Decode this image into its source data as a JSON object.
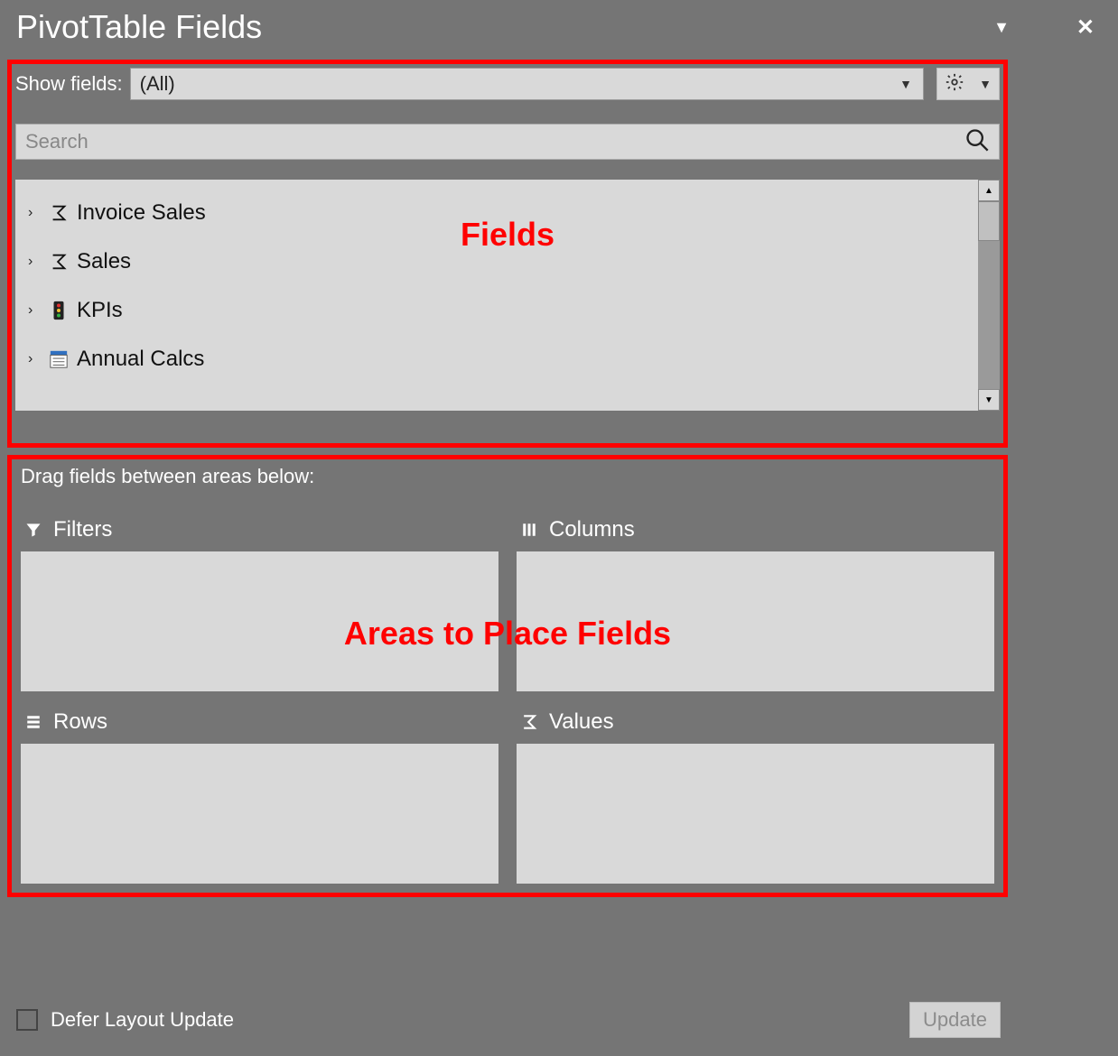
{
  "header": {
    "title": "PivotTable Fields"
  },
  "show_fields": {
    "label": "Show fields:",
    "selected": "(All)"
  },
  "search": {
    "placeholder": "Search"
  },
  "fields": {
    "items": [
      {
        "icon": "sigma",
        "label": "Invoice Sales"
      },
      {
        "icon": "sigma",
        "label": "Sales"
      },
      {
        "icon": "kpi",
        "label": "KPIs"
      },
      {
        "icon": "table",
        "label": "Annual Calcs"
      }
    ],
    "annotation": "Fields"
  },
  "drag_section": {
    "label": "Drag fields between areas below:",
    "areas": {
      "filters": {
        "label": "Filters"
      },
      "columns": {
        "label": "Columns"
      },
      "rows": {
        "label": "Rows"
      },
      "values": {
        "label": "Values"
      }
    },
    "annotation": "Areas to Place Fields"
  },
  "footer": {
    "defer_label": "Defer Layout Update",
    "update_label": "Update"
  }
}
